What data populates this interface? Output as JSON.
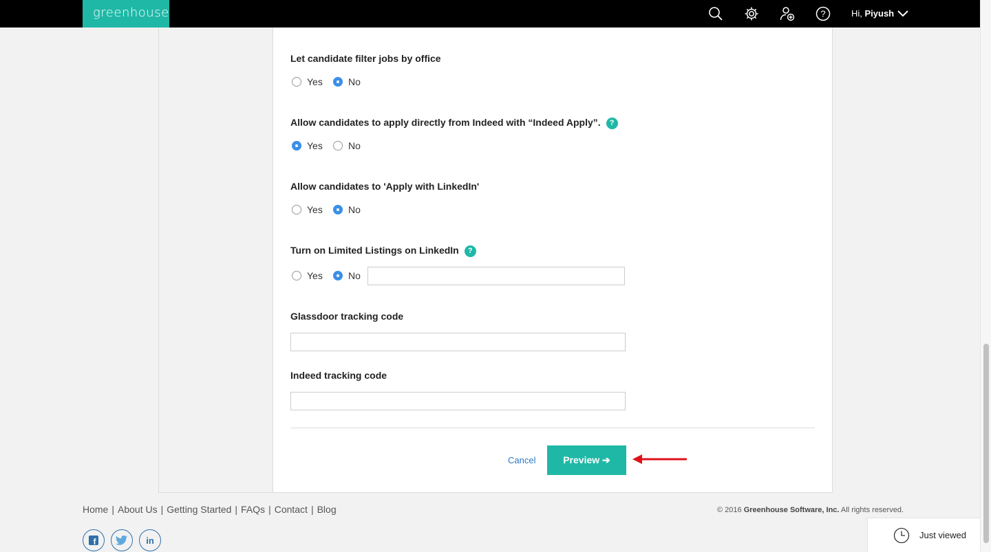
{
  "header": {
    "logo": "greenhouse",
    "greeting_prefix": "Hi, ",
    "user_name": "Piyush",
    "icons": [
      "search-icon",
      "gear-icon",
      "add-user-icon",
      "help-icon",
      "chevron-down-icon"
    ]
  },
  "form": {
    "filter_office": {
      "label": "Let candidate filter jobs by office",
      "yes": "Yes",
      "no": "No",
      "selected": "No"
    },
    "indeed_apply": {
      "label": "Allow candidates to apply directly from Indeed with “Indeed Apply”.",
      "help": "?",
      "yes": "Yes",
      "no": "No",
      "selected": "Yes"
    },
    "linkedin_apply": {
      "label": "Allow candidates to 'Apply with LinkedIn'",
      "yes": "Yes",
      "no": "No",
      "selected": "No"
    },
    "limited_listings": {
      "label": "Turn on Limited Listings on LinkedIn",
      "help": "?",
      "yes": "Yes",
      "no": "No",
      "selected": "No",
      "input_value": ""
    },
    "glassdoor": {
      "label": "Glassdoor tracking code",
      "value": ""
    },
    "indeed_tracking": {
      "label": "Indeed tracking code",
      "value": ""
    },
    "cancel_label": "Cancel",
    "preview_label": "Preview ➔"
  },
  "footer": {
    "links": [
      "Home",
      "About Us",
      "Getting Started",
      "FAQs",
      "Contact",
      "Blog"
    ],
    "separator": "|",
    "copyright_prefix": "© 2016 ",
    "copyright_company": "Greenhouse Software, Inc.",
    "copyright_suffix": " All rights reserved.",
    "social": [
      "facebook-icon",
      "twitter-icon",
      "linkedin-icon"
    ],
    "linkedin_text": "in",
    "facebook_text": "f",
    "just_viewed": "Just viewed"
  },
  "colors": {
    "brand": "#1fb8a6",
    "radio_selected": "#3b8fe8",
    "annotation_arrow": "#e0111b"
  }
}
